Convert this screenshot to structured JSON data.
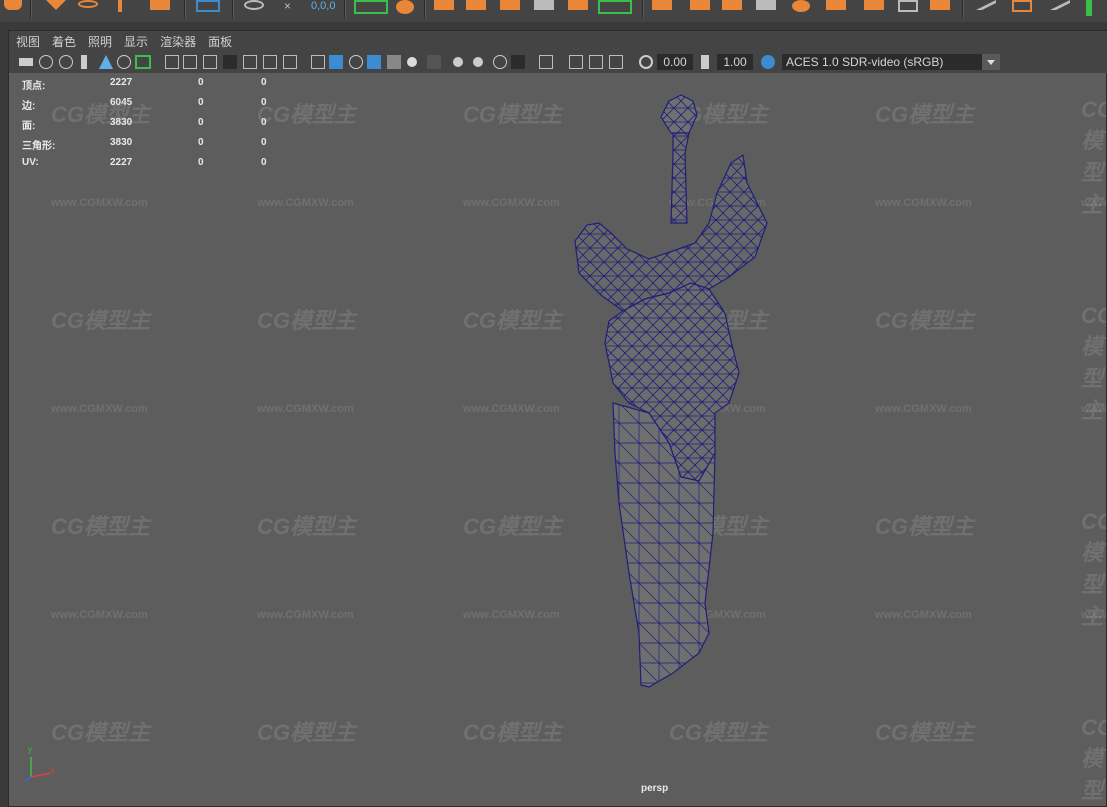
{
  "shelf": {
    "coord_readout": "0,0,0"
  },
  "panel_menu": [
    "视图",
    "着色",
    "照明",
    "显示",
    "渲染器",
    "面板"
  ],
  "toolbar": {
    "exposure": "0.00",
    "gamma": "1.00",
    "color_space": "ACES 1.0 SDR-video (sRGB)"
  },
  "hud": {
    "rows": [
      {
        "label": "顶点:",
        "v1": "2227",
        "v2": "0",
        "v3": "0"
      },
      {
        "label": "边:",
        "v1": "6045",
        "v2": "0",
        "v3": "0"
      },
      {
        "label": "面:",
        "v1": "3830",
        "v2": "0",
        "v3": "0"
      },
      {
        "label": "三角形:",
        "v1": "3830",
        "v2": "0",
        "v3": "0"
      },
      {
        "label": "UV:",
        "v1": "2227",
        "v2": "0",
        "v3": "0"
      }
    ]
  },
  "watermark": {
    "logo_text": "CG模型主",
    "url_text": "www.CGMXW.com"
  },
  "viewport": {
    "camera_label": "persp",
    "axis_y": "y",
    "axis_x": "x"
  },
  "colors": {
    "accent": "#3d8bd0",
    "wire": "#1f1f7a",
    "shelf_icon": "#e8873a"
  }
}
